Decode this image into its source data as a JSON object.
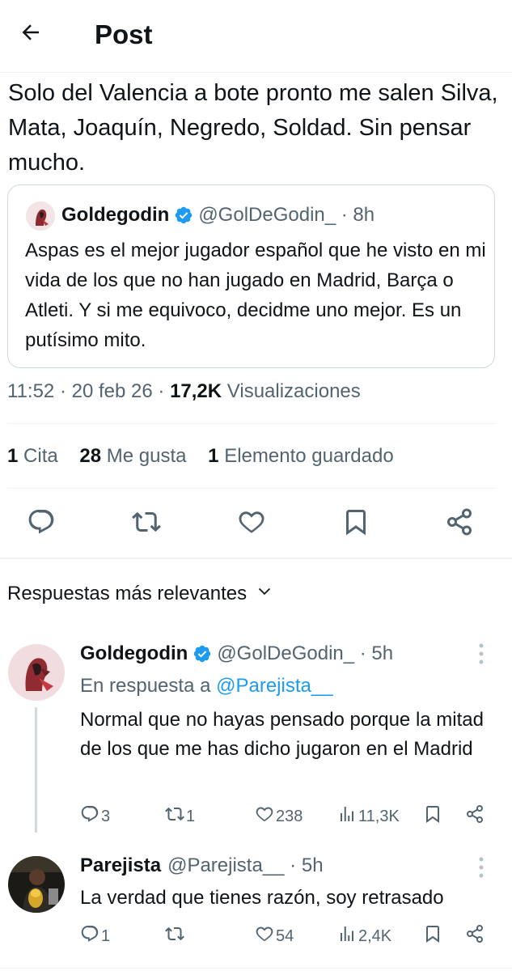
{
  "header": {
    "title": "Post"
  },
  "post": {
    "text": "Solo del Valencia a bote pronto me salen Silva, Mata, Joaquín, Negredo, Soldad. Sin pensar mucho.",
    "time": "11:52",
    "date": "20 feb 26",
    "views_count": "17,2K",
    "views_label": "Visualizaciones",
    "stats": {
      "quotes_count": "1",
      "quotes_label": "Cita",
      "likes_count": "28",
      "likes_label": "Me gusta",
      "bookmarks_count": "1",
      "bookmarks_label": "Elemento guardado"
    }
  },
  "quoted": {
    "name": "Goldegodin",
    "handle": "@GolDeGodin_",
    "time": "8h",
    "text": "Aspas es el mejor jugador español que he visto en mi vida de los que no han jugado en Madrid, Barça o Atleti. Y si me equivoco, decidme uno mejor. Es un putísimo mito."
  },
  "replies_section": {
    "sort_label": "Respuestas más relevantes"
  },
  "replies": [
    {
      "name": "Goldegodin",
      "handle": "@GolDeGodin_",
      "time": "5h",
      "replying_prefix": "En respuesta a",
      "replying_to": "@Parejista__",
      "text": "Normal que no hayas pensado porque la mitad de los que me has dicho jugaron en el Madrid",
      "replies": "3",
      "retweets": "1",
      "likes": "238",
      "views": "11,3K"
    },
    {
      "name": "Parejista",
      "handle": "@Parejista__",
      "time": "5h",
      "text": "La verdad que tienes razón, soy retrasado",
      "replies": "1",
      "retweets": "",
      "likes": "54",
      "views": "2,4K"
    }
  ],
  "icons": {
    "back": "arrow-left-icon",
    "verified": "verified-badge-icon",
    "reply": "reply-icon",
    "retweet": "retweet-icon",
    "like": "heart-icon",
    "bookmark": "bookmark-icon",
    "share": "share-icon",
    "views": "views-icon",
    "more": "more-icon",
    "chevron": "chevron-down-icon"
  },
  "colors": {
    "text": "#0f1419",
    "secondary": "#536471",
    "accent": "#1d9bf0",
    "border": "#eff3f4"
  }
}
